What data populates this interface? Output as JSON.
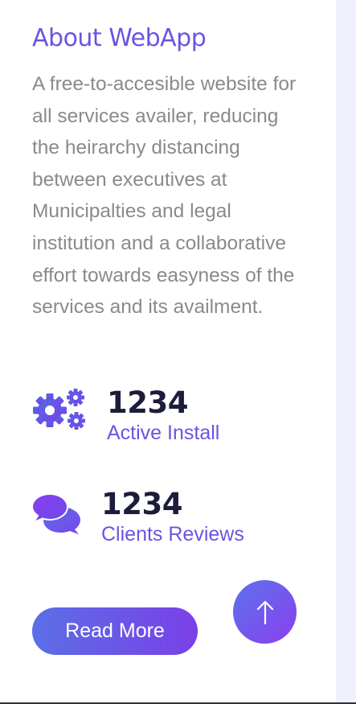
{
  "about": {
    "title": "About WebApp",
    "description": "A free-to-accesible website for all services availer, reducing the heirarchy distancing between executives at Municipalties and legal institution and a collaborative effort towards easyness of the services and its availment."
  },
  "stats": {
    "install": {
      "number": "1234",
      "label": "Active Install",
      "icon": "gears-icon"
    },
    "reviews": {
      "number": "1234",
      "label": "Clients Reviews",
      "icon": "chat-bubbles-icon"
    }
  },
  "buttons": {
    "read_more": "Read More",
    "scroll_top_icon": "arrow-up-icon"
  },
  "colors": {
    "accent": "#6a55e0",
    "heading_dark": "#1c1d3a",
    "body_text": "#8a8a8a",
    "gradient_start": "#5b6fe6",
    "gradient_end": "#8a3ff0"
  }
}
